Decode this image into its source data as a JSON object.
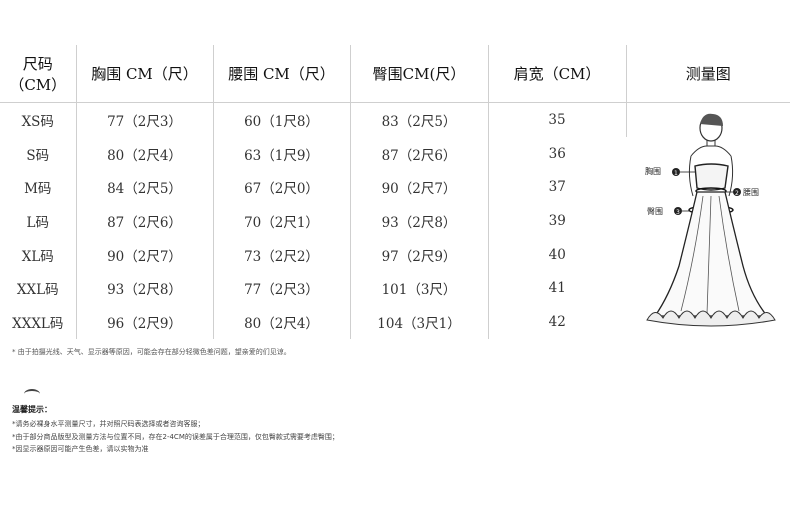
{
  "table": {
    "headers": [
      "尺码（CM）",
      "胸围 CM（尺）",
      "腰围 CM（尺）",
      "臀围CM(尺）",
      "肩宽（CM）",
      "测量图"
    ],
    "header_size_line1": "尺码",
    "header_size_line2": "（CM）",
    "rows": [
      [
        "XS码",
        "77（2尺3）",
        "60（1尺8）",
        "83（2尺5）",
        "35"
      ],
      [
        "S码",
        "80（2尺4）",
        "63（1尺9）",
        "87（2尺6）",
        "36"
      ],
      [
        "M码",
        "84（2尺5）",
        "67（2尺0）",
        "90（2尺7）",
        "37"
      ],
      [
        "L码",
        "87（2尺6）",
        "70（2尺1）",
        "93（2尺8）",
        "39"
      ],
      [
        "XL码",
        "90（2尺7）",
        "73（2尺2）",
        "97（2尺9）",
        "40"
      ],
      [
        "XXL码",
        "93（2尺8）",
        "77（2尺3）",
        "101（3尺）",
        "41"
      ],
      [
        "XXXL码",
        "96（2尺9）",
        "80（2尺4）",
        "104（3尺1）",
        "42"
      ]
    ]
  },
  "figure": {
    "label_chest": "胸围",
    "label_waist": "腰围",
    "label_hip": "臀围",
    "num_1": "1",
    "num_2": "2",
    "num_3": "3"
  },
  "note": "* 由于拍摄光线、天气、显示器等原因，可能会存在部分轻微色差问题，望亲爱的们见谅。",
  "tips": {
    "title": "温馨提示：",
    "lines": [
      "*请务必裸身水平测量尺寸，并对照尺码表选择或者咨询客服；",
      "*由于部分商品版型及测量方法与位置不同，存在2-4CM的误差属于合理范围，仅包臀款式需要考虑臀围；",
      "*因显示器原因可能产生色差，请以实物为准"
    ]
  }
}
